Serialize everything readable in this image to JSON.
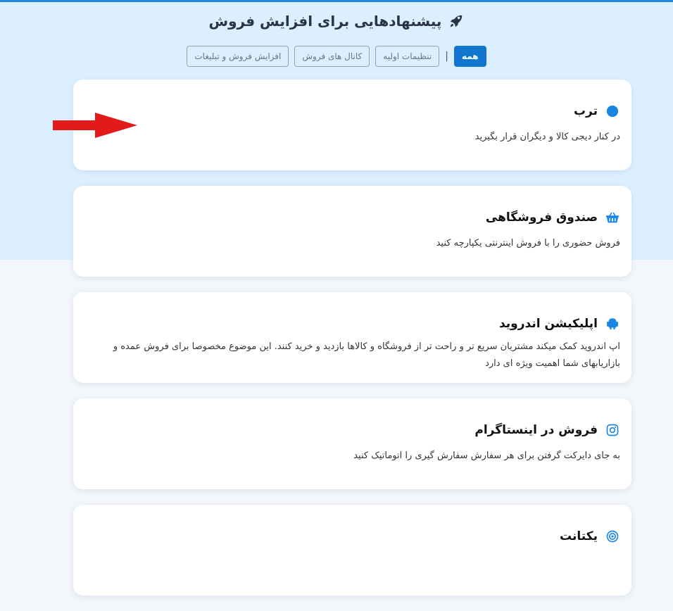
{
  "header": {
    "title": "پیشنهادهایی برای افزایش فروش",
    "icon": "rocket-icon"
  },
  "tabs": [
    {
      "label": "همه",
      "active": true
    },
    {
      "label": "تنظیمات اولیه",
      "active": false
    },
    {
      "label": "کانال های فروش",
      "active": false
    },
    {
      "label": "افزایش فروش و تبلیغات",
      "active": false
    }
  ],
  "cards": [
    {
      "title": "ترب",
      "desc": "در کنار دیجی کالا و دیگران قرار بگیرید",
      "icon": "blue-dot-icon"
    },
    {
      "title": "صندوق فروشگاهی",
      "desc": "فروش حضوری را با فروش اینترنتی یکپارچه کنید",
      "icon": "basket-icon"
    },
    {
      "title": "اپلیکیشن اندروید",
      "desc": "اپ اندروید کمک میکند مشتریان سریع تر و راحت تر از فروشگاه و کالاها بازدید و خرید کنند. این موضوع مخصوصا برای فروش عمده و بازاریابهای شما اهمیت ویژه ای دارد",
      "icon": "android-icon"
    },
    {
      "title": "فروش در اینستاگرام",
      "desc": "به جای دایرکت گرفتن برای هر سفارش سفارش گیری را اتوماتیک کنید",
      "icon": "instagram-icon"
    },
    {
      "title": "یکتانت",
      "desc": "",
      "icon": "target-icon"
    }
  ],
  "colors": {
    "accent": "#1276d1",
    "hero": "#dbefff",
    "arrow": "#e3191c"
  }
}
